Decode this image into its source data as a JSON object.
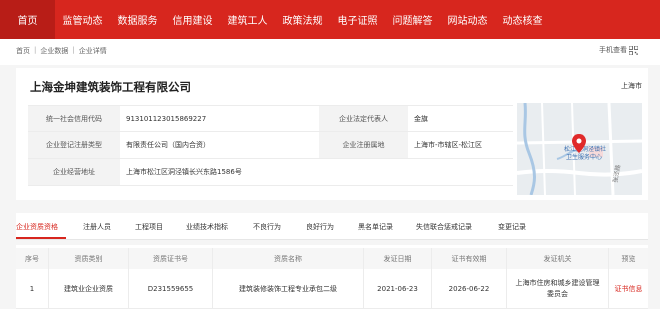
{
  "nav": [
    "首页",
    "监管动态",
    "数据服务",
    "信用建设",
    "建筑工人",
    "政策法规",
    "电子证照",
    "问题解答",
    "网站动态",
    "动态核查"
  ],
  "breadcrumb": [
    "首页",
    "企业数据",
    "企业详情"
  ],
  "mobile_label": "手机查看",
  "company": {
    "name": "上海金坤建筑装饰工程有限公司",
    "region": "上海市"
  },
  "info": {
    "credit_code_label": "统一社会信用代码",
    "credit_code": "913101123015869227",
    "legal_rep_label": "企业法定代表人",
    "legal_rep": "金旗",
    "reg_type_label": "企业登记注册类型",
    "reg_type": "有限责任公司（国内合资）",
    "reg_area_label": "企业注册属地",
    "reg_area": "上海市-市辖区-松江区",
    "address_label": "企业经营地址",
    "address": "上海市松江区洞泾镇长兴东路1586号"
  },
  "map": {
    "label": "松江区洞泾镇社区卫生服务中心",
    "label_line1": "松江区洞泾镇社",
    "label_line2": "卫生服务中心",
    "road_label": "张泾路"
  },
  "tabs": [
    "企业资质资格",
    "注册人员",
    "工程项目",
    "业绩技术指标",
    "不良行为",
    "良好行为",
    "黑名单记录",
    "失信联合惩戒记录",
    "变更记录"
  ],
  "table": {
    "headers": [
      "序号",
      "资质类别",
      "资质证书号",
      "资质名称",
      "发证日期",
      "证书有效期",
      "发证机关",
      "预览"
    ],
    "rows": [
      [
        "1",
        "建筑业企业资质",
        "D231559655",
        "建筑装修装饰工程专业承包二级",
        "2021-06-23",
        "2026-06-22",
        "上海市住房和城乡建设管理委员会",
        "证书信息"
      ]
    ]
  },
  "colors": {
    "primary": "#d7261e",
    "active": "#b81d17"
  }
}
